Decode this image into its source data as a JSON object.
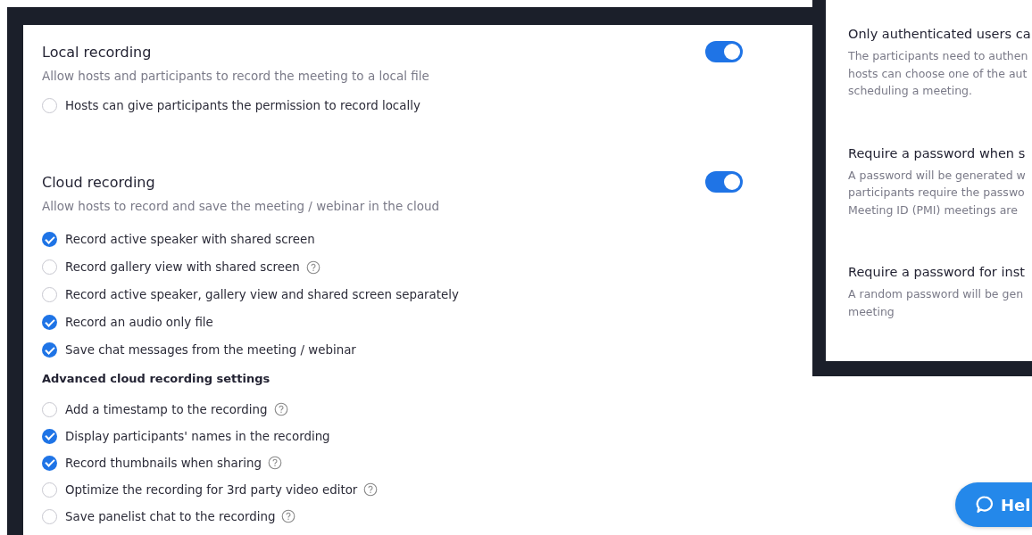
{
  "sections": [
    {
      "title": "Local recording",
      "description": "Allow hosts and participants to record the meeting to a local file",
      "enabled": true,
      "items": [
        {
          "kind": "checkbox",
          "label": "Hosts can give participants the permission to record locally",
          "checked": false,
          "info": false
        }
      ]
    },
    {
      "title": "Cloud recording",
      "description": "Allow hosts to record and save the meeting / webinar in the cloud",
      "enabled": true,
      "items": [
        {
          "kind": "checkbox",
          "label": "Record active speaker with shared screen",
          "checked": true,
          "info": false
        },
        {
          "kind": "checkbox",
          "label": "Record gallery view with shared screen",
          "checked": false,
          "info": true
        },
        {
          "kind": "checkbox",
          "label": "Record active speaker, gallery view and shared screen separately",
          "checked": false,
          "info": false
        },
        {
          "kind": "checkbox",
          "label": "Record an audio only file",
          "checked": true,
          "info": false
        },
        {
          "kind": "checkbox",
          "label": "Save chat messages from the meeting / webinar",
          "checked": true,
          "info": false
        },
        {
          "kind": "subheading",
          "label": "Advanced cloud recording settings"
        },
        {
          "kind": "checkbox",
          "label": "Add a timestamp to the recording",
          "checked": false,
          "info": true
        },
        {
          "kind": "checkbox",
          "label": "Display participants' names in the recording",
          "checked": true,
          "info": false
        },
        {
          "kind": "checkbox",
          "label": "Record thumbnails when sharing",
          "checked": true,
          "info": true
        },
        {
          "kind": "checkbox",
          "label": "Optimize the recording for 3rd party video editor",
          "checked": false,
          "info": true
        },
        {
          "kind": "checkbox",
          "label": "Save panelist chat to the recording",
          "checked": false,
          "info": true
        }
      ]
    }
  ],
  "overlay_panel": {
    "settings": [
      {
        "title": "Only authenticated users ca",
        "description": "The participants need to authen\nhosts can choose one of the aut\nscheduling a meeting."
      },
      {
        "title": "Require a password when s",
        "description": "A password will be generated w\nparticipants require the passwo\nMeeting ID (PMI) meetings are"
      },
      {
        "title": "Require a password for inst",
        "description": "A random password will be gen\nmeeting"
      }
    ]
  },
  "help_button": {
    "label": "Hel"
  }
}
